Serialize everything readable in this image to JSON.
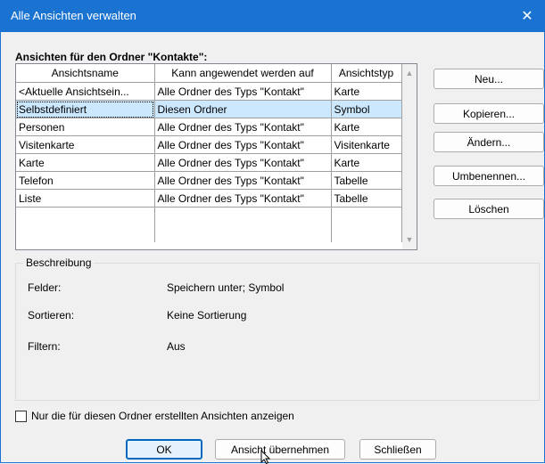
{
  "window": {
    "title": "Alle Ansichten verwalten",
    "close_glyph": "✕"
  },
  "views": {
    "label": "Ansichten für den Ordner \"Kontakte\":",
    "columns": [
      "Ansichtsname",
      "Kann angewendet werden auf",
      "Ansichtstyp"
    ],
    "rows": [
      [
        "<Aktuelle Ansichtsein...",
        "Alle Ordner des Typs \"Kontakt\"",
        "Karte"
      ],
      [
        "Selbstdefiniert",
        "Diesen Ordner",
        "Symbol"
      ],
      [
        "Personen",
        "Alle Ordner des Typs \"Kontakt\"",
        "Karte"
      ],
      [
        "Visitenkarte",
        "Alle Ordner des Typs \"Kontakt\"",
        "Visitenkarte"
      ],
      [
        "Karte",
        "Alle Ordner des Typs \"Kontakt\"",
        "Karte"
      ],
      [
        "Telefon",
        "Alle Ordner des Typs \"Kontakt\"",
        "Tabelle"
      ],
      [
        "Liste",
        "Alle Ordner des Typs \"Kontakt\"",
        "Tabelle"
      ]
    ],
    "selected_row": 1
  },
  "side_buttons": {
    "new": "Neu...",
    "copy": "Kopieren...",
    "modify": "Ändern...",
    "rename": "Umbenennen...",
    "delete": "Löschen"
  },
  "description": {
    "legend": "Beschreibung",
    "fields_label": "Felder:",
    "fields_value": "Speichern unter; Symbol",
    "sort_label": "Sortieren:",
    "sort_value": "Keine Sortierung",
    "filter_label": "Filtern:",
    "filter_value": "Aus"
  },
  "checkbox": {
    "label": "Nur die für diesen Ordner erstellten Ansichten anzeigen",
    "checked": false
  },
  "footer_buttons": {
    "ok": "OK",
    "apply": "Ansicht übernehmen",
    "close": "Schließen"
  },
  "colors": {
    "titlebar": "#1a73d1",
    "selection": "#cce8ff"
  }
}
